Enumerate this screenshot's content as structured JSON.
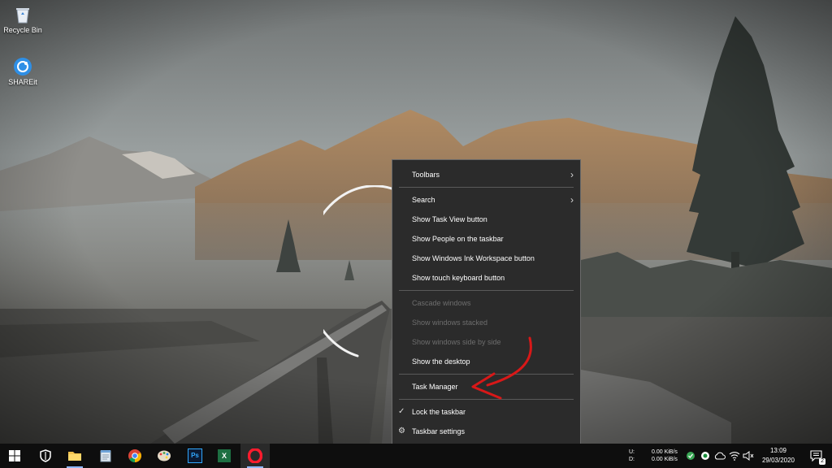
{
  "desktop": {
    "icons": [
      {
        "label": "Recycle Bin",
        "icon": "recycle-bin-icon"
      },
      {
        "label": "SHAREit",
        "icon": "shareit-icon"
      }
    ]
  },
  "context_menu": {
    "items": [
      {
        "label": "Toolbars",
        "submenu": true,
        "enabled": true
      },
      {
        "label": "Search",
        "submenu": true,
        "enabled": true
      },
      {
        "label": "Show Task View button",
        "enabled": true
      },
      {
        "label": "Show People on the taskbar",
        "enabled": true
      },
      {
        "label": "Show Windows Ink Workspace button",
        "enabled": true
      },
      {
        "label": "Show touch keyboard button",
        "enabled": true
      },
      {
        "label": "Cascade windows",
        "enabled": false
      },
      {
        "label": "Show windows stacked",
        "enabled": false
      },
      {
        "label": "Show windows side by side",
        "enabled": false
      },
      {
        "label": "Show the desktop",
        "enabled": true
      },
      {
        "label": "Task Manager",
        "enabled": true,
        "highlighted_by_arrow": true
      },
      {
        "label": "Lock the taskbar",
        "enabled": true,
        "checked": true
      },
      {
        "label": "Taskbar settings",
        "enabled": true,
        "icon": "gear-icon"
      }
    ]
  },
  "taskbar": {
    "apps": [
      {
        "name": "start",
        "icon": "windows-logo-icon"
      },
      {
        "name": "security",
        "icon": "shield-icon"
      },
      {
        "name": "file-explorer",
        "icon": "folder-icon",
        "running": true
      },
      {
        "name": "notepad",
        "icon": "notepad-icon"
      },
      {
        "name": "chrome",
        "icon": "chrome-icon"
      },
      {
        "name": "paint",
        "icon": "paint-palette-icon"
      },
      {
        "name": "photoshop",
        "icon": "photoshop-icon",
        "text": "Ps"
      },
      {
        "name": "excel",
        "icon": "excel-icon",
        "text": "X"
      },
      {
        "name": "opera",
        "icon": "opera-icon",
        "running": true
      }
    ],
    "network_speed": {
      "up_label": "U:",
      "down_label": "D:",
      "up_value": "0.00 KiB/s",
      "down_value": "0.00 KiB/s"
    },
    "clock": {
      "time": "13:09",
      "date": "29/03/2020"
    },
    "notifications": {
      "count": "2"
    }
  },
  "colors": {
    "menu_bg": "#2b2b2b",
    "menu_text": "#ffffff",
    "menu_disabled": "#6e6e6e",
    "taskbar_bg": "#0e0e0e",
    "arrow": "#d81818"
  }
}
